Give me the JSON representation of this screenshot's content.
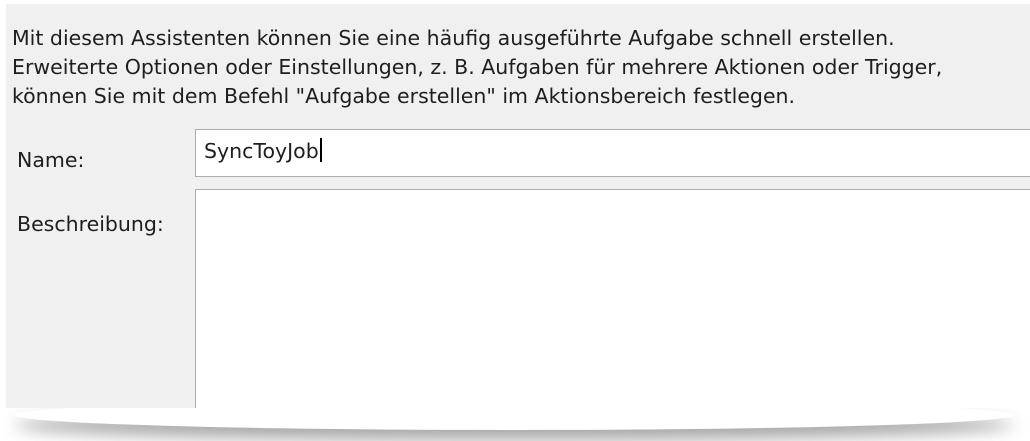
{
  "intro": {
    "line1": "Mit diesem Assistenten können Sie eine häufig ausgeführte Aufgabe schnell erstellen.",
    "line2": "Erweiterte Optionen oder Einstellungen, z. B. Aufgaben für mehrere Aktionen oder Trigger,",
    "line3": "können Sie mit dem Befehl \"Aufgabe erstellen\" im Aktionsbereich festlegen."
  },
  "form": {
    "name_label": "Name:",
    "name_value": "SyncToyJob",
    "description_label": "Beschreibung:",
    "description_value": ""
  }
}
